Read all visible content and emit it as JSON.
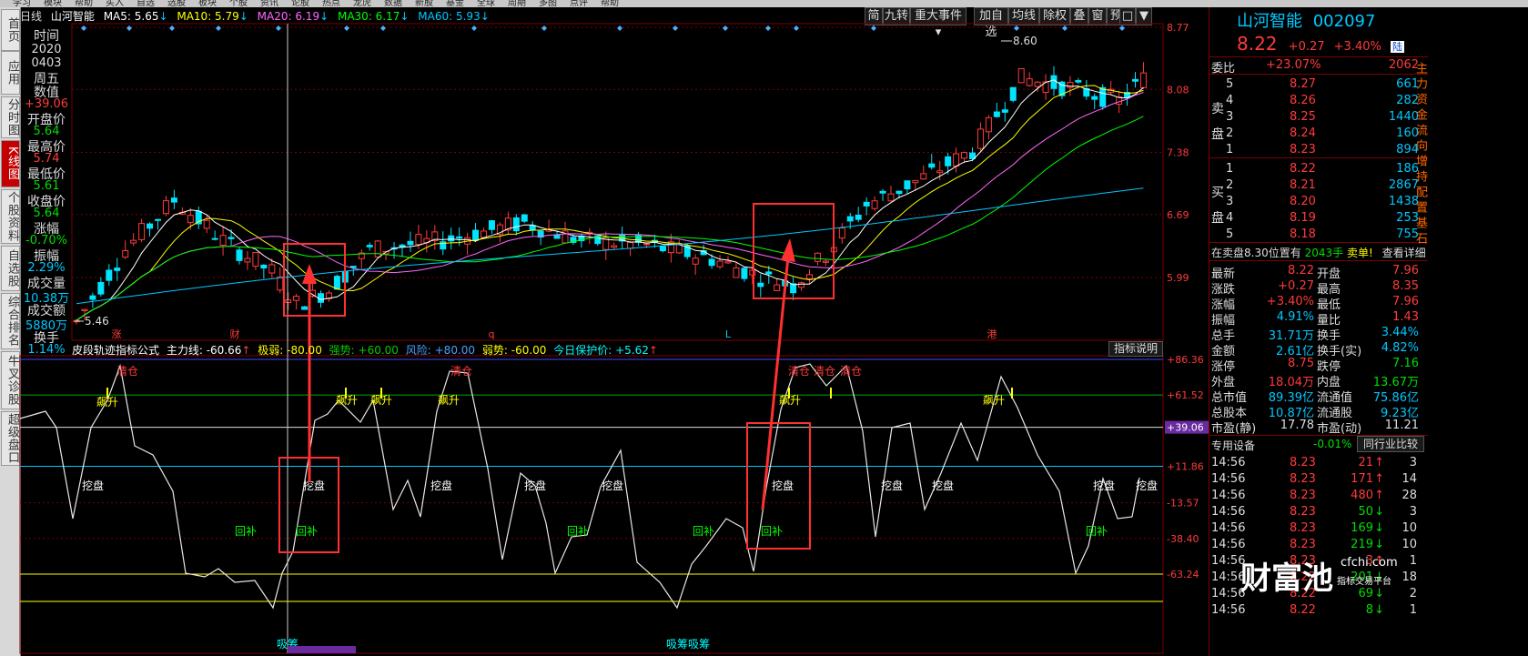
{
  "menu": [
    "学习",
    "模块",
    "帮助",
    "买入",
    "自选",
    "选股",
    "板块",
    "个股",
    "资讯",
    "论股",
    "热点",
    "龙虎",
    "数据",
    "新股",
    "基金",
    "全球",
    "周期",
    "多图",
    "点评",
    "帮助"
  ],
  "nav_tabs": [
    "首页",
    "应用",
    "分时图",
    "K线图",
    "个股资料",
    "自选股",
    "综合排名",
    "牛叉诊股",
    "超级盘口"
  ],
  "chart_header": {
    "period": "日线",
    "name": "山河智能",
    "ma5": "MA5: 5.65",
    "ma10": "MA10: 5.79",
    "ma20": "MA20: 6.19",
    "ma30": "MA30: 6.17",
    "ma60": "MA60: 5.93"
  },
  "toolbar": [
    "简",
    "九转",
    "重大事件",
    "加自选",
    "均线",
    "除权",
    "叠",
    "窗",
    "预测"
  ],
  "info_panel": {
    "time_label": "时间",
    "year": "2020",
    "date": "0403",
    "weekday": "周五",
    "value_label": "数值",
    "value": "+39.06",
    "open_label": "开盘价",
    "open": "5.64",
    "high_label": "最高价",
    "high": "5.74",
    "low_label": "最低价",
    "low": "5.61",
    "close_label": "收盘价",
    "close": "5.64",
    "change_label": "涨幅",
    "change": "-0.70%",
    "amp_label": "振幅",
    "amp": "2.29%",
    "vol_label": "成交量",
    "vol": "10.38万",
    "amt_label": "成交额",
    "amt": "5880万",
    "turn_label": "换手",
    "turn": "1.14%"
  },
  "price_axis": [
    "8.77",
    "8.08",
    "7.38",
    "6.69",
    "5.99"
  ],
  "price_markers": {
    "high": "8.60",
    "low": "5.46"
  },
  "candle_markers": [
    "涨",
    "财",
    "q",
    "L",
    "港"
  ],
  "indicator_header": {
    "name": "皮段轨迹指标公式",
    "main": "主力线: -60.66",
    "extreme": "极弱: -80.00",
    "strong": "强势: +60.00",
    "risk": "风险: +80.00",
    "weak": "弱势: -60.00",
    "protect": "今日保护价: +5.62",
    "explain_button": "指标说明"
  },
  "indicator_axis": [
    "+86.36",
    "+61.52",
    "+39.06",
    "+11.86",
    "-13.57",
    "-38.40",
    "-63.24"
  ],
  "indicator_labels": {
    "qingcang": "清仓",
    "biaosheng": "飙升",
    "wapan": "挖盘",
    "huibu": "回补",
    "xichou": "吸筹"
  },
  "right_panel": {
    "name": "山河智能",
    "code": "002097",
    "price": "8.22",
    "change": "+0.27",
    "pct": "+3.40%",
    "badge": "陆",
    "webi_label": "委比",
    "webi_pct": "+23.07%",
    "webi_diff": "2062",
    "sell_label": [
      "卖",
      "盘"
    ],
    "buy_label": [
      "买",
      "盘"
    ],
    "sell": [
      {
        "lvl": "5",
        "price": "8.27",
        "vol": "661"
      },
      {
        "lvl": "4",
        "price": "8.26",
        "vol": "282"
      },
      {
        "lvl": "3",
        "price": "8.25",
        "vol": "1440"
      },
      {
        "lvl": "2",
        "price": "8.24",
        "vol": "160"
      },
      {
        "lvl": "1",
        "price": "8.23",
        "vol": "894"
      }
    ],
    "buy": [
      {
        "lvl": "1",
        "price": "8.22",
        "vol": "186"
      },
      {
        "lvl": "2",
        "price": "8.21",
        "vol": "2867"
      },
      {
        "lvl": "3",
        "price": "8.20",
        "vol": "1438"
      },
      {
        "lvl": "4",
        "price": "8.19",
        "vol": "253"
      },
      {
        "lvl": "5",
        "price": "8.18",
        "vol": "755"
      }
    ],
    "notice_text": "在卖盘8.30位置有",
    "notice_vol": "2043手",
    "notice_sell": "卖单!",
    "notice_detail": "查看详细",
    "stats": [
      {
        "l1": "最新",
        "v1": "8.22",
        "c1": "red",
        "l2": "开盘",
        "v2": "7.96",
        "c2": "red"
      },
      {
        "l1": "涨跌",
        "v1": "+0.27",
        "c1": "red",
        "l2": "最高",
        "v2": "8.35",
        "c2": "red"
      },
      {
        "l1": "涨幅",
        "v1": "+3.40%",
        "c1": "red",
        "l2": "最低",
        "v2": "7.96",
        "c2": "red"
      },
      {
        "l1": "振幅",
        "v1": "4.91%",
        "c1": "cyan",
        "l2": "量比",
        "v2": "1.43",
        "c2": "red"
      },
      {
        "l1": "总手",
        "v1": "31.71万",
        "c1": "cyan",
        "l2": "换手",
        "v2": "3.44%",
        "c2": "cyan"
      },
      {
        "l1": "金额",
        "v1": "2.61亿",
        "c1": "cyan",
        "l2": "换手(实)",
        "v2": "4.82%",
        "c2": "cyan"
      },
      {
        "l1": "涨停",
        "v1": "8.75",
        "c1": "red",
        "l2": "跌停",
        "v2": "7.16",
        "c2": "green"
      },
      {
        "l1": "外盘",
        "v1": "18.04万",
        "c1": "red",
        "l2": "内盘",
        "v2": "13.67万",
        "c2": "green"
      },
      {
        "l1": "总市值",
        "v1": "89.39亿",
        "c1": "cyan",
        "l2": "流通值",
        "v2": "75.86亿",
        "c2": "cyan"
      },
      {
        "l1": "总股本",
        "v1": "10.87亿",
        "c1": "cyan",
        "l2": "流通股",
        "v2": "9.23亿",
        "c2": "cyan"
      },
      {
        "l1": "市盈(静)",
        "v1": "17.78",
        "c1": "white",
        "l2": "市盈(动)",
        "v2": "11.21",
        "c2": "white"
      }
    ],
    "industry": "专用设备",
    "industry_pct": "-0.01%",
    "compare_button": "同行业比较",
    "ticks": [
      {
        "t": "14:56",
        "p": "8.23",
        "v": "21",
        "d": "up",
        "n": "3"
      },
      {
        "t": "14:56",
        "p": "8.23",
        "v": "171",
        "d": "up",
        "n": "14"
      },
      {
        "t": "14:56",
        "p": "8.23",
        "v": "480",
        "d": "up",
        "n": "28"
      },
      {
        "t": "14:56",
        "p": "8.23",
        "v": "50",
        "d": "down",
        "n": "3"
      },
      {
        "t": "14:56",
        "p": "8.23",
        "v": "169",
        "d": "down",
        "n": "10"
      },
      {
        "t": "14:56",
        "p": "8.23",
        "v": "219",
        "d": "down",
        "n": "10"
      },
      {
        "t": "14:56",
        "p": "8.23",
        "v": "3",
        "d": "up",
        "n": "1"
      },
      {
        "t": "14:56",
        "p": "8.22",
        "v": "201",
        "d": "down",
        "n": "18"
      },
      {
        "t": "14:56",
        "p": "8.22",
        "v": "69",
        "d": "down",
        "n": "2"
      },
      {
        "t": "14:56",
        "p": "8.22",
        "v": "8",
        "d": "down",
        "n": "1"
      }
    ],
    "side_text": "主力资金流向增持配置基石"
  },
  "watermark": {
    "brand": "财富池",
    "domain": "cfchi.com",
    "slogan": "指标交易平台"
  }
}
